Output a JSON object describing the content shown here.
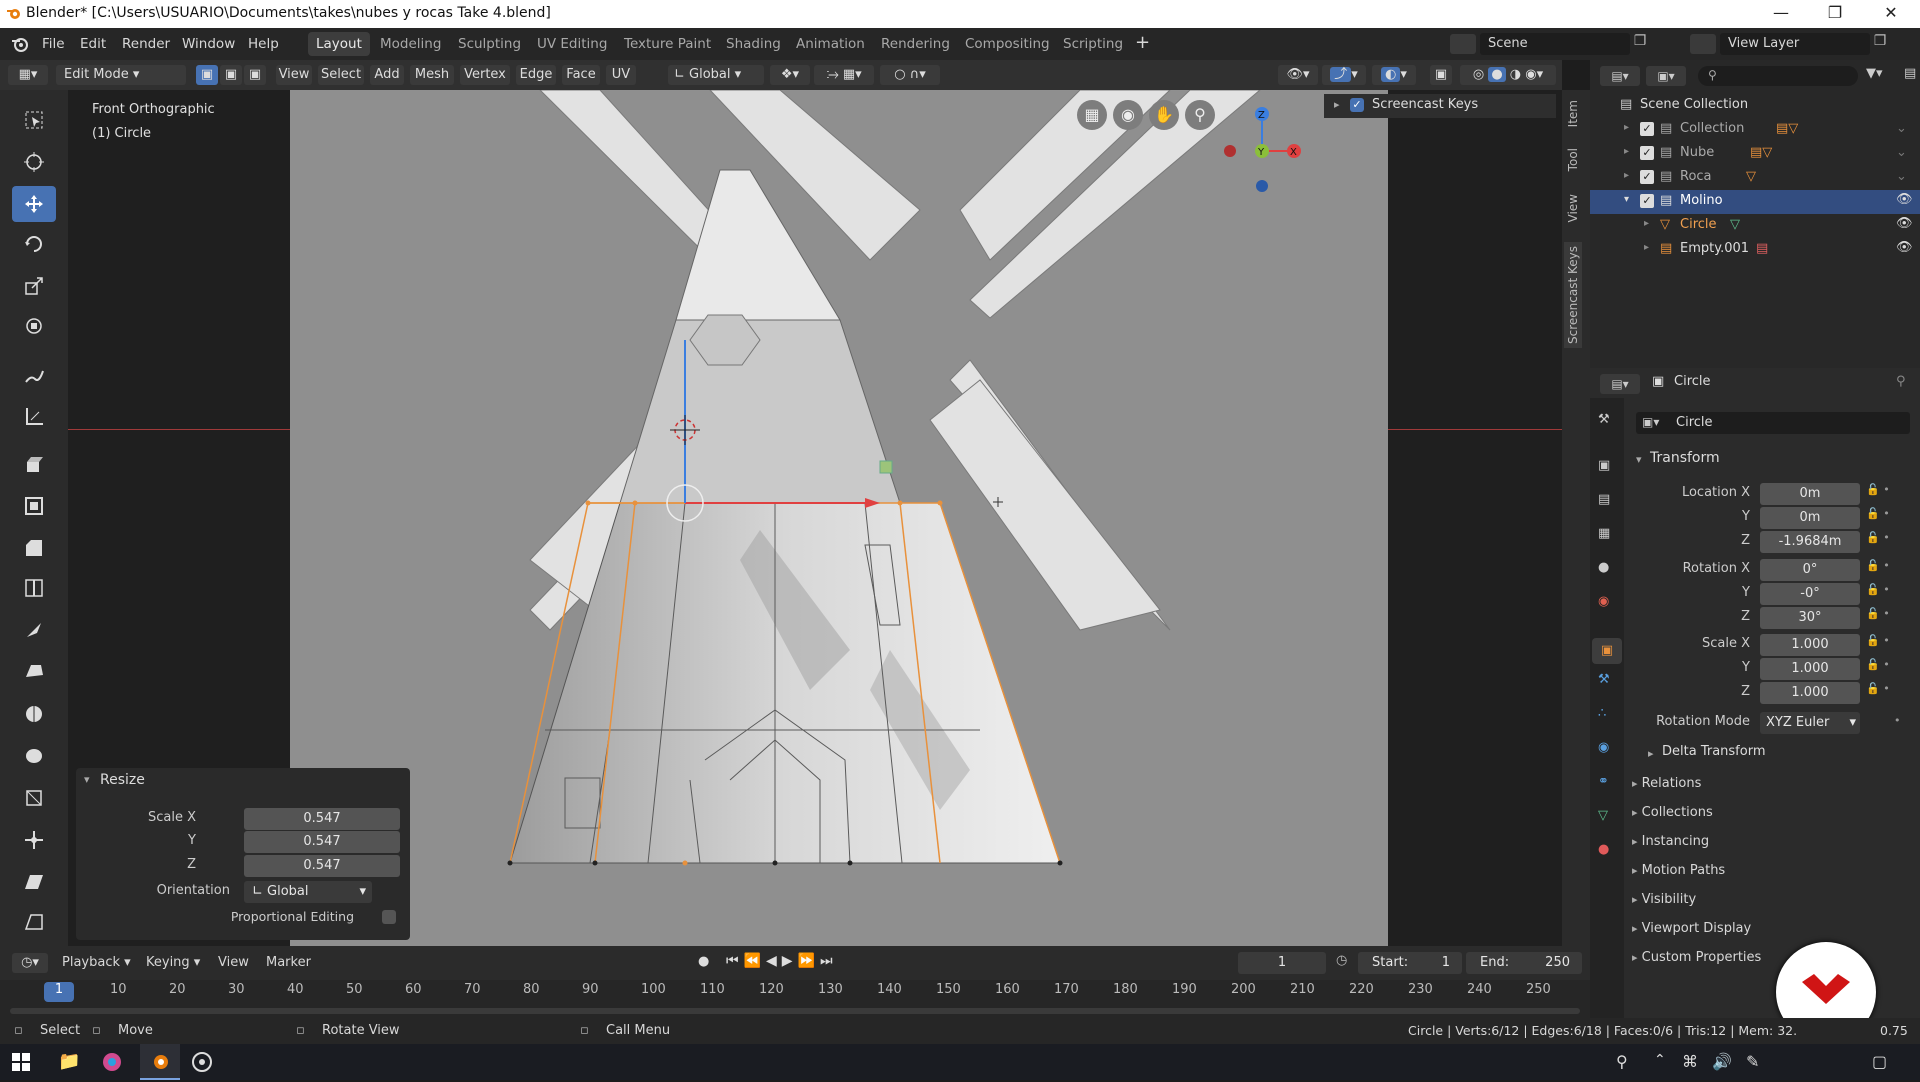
{
  "window": {
    "title": "Blender* [C:\\Users\\USUARIO\\Documents\\takes\\nubes y rocas Take 4.blend]"
  },
  "menu": [
    "File",
    "Edit",
    "Render",
    "Window",
    "Help"
  ],
  "workspaces": [
    "Layout",
    "Modeling",
    "Sculpting",
    "UV Editing",
    "Texture Paint",
    "Shading",
    "Animation",
    "Rendering",
    "Compositing",
    "Scripting"
  ],
  "active_workspace": "Layout",
  "scene": {
    "name": "Scene",
    "view_layer": "View Layer"
  },
  "viewport_header": {
    "mode": "Edit Mode",
    "menus": [
      "View",
      "Select",
      "Add",
      "Mesh",
      "Vertex",
      "Edge",
      "Face",
      "UV"
    ],
    "orientation": "Global"
  },
  "viewport": {
    "view_name": "Front Orthographic",
    "object_label": "(1) Circle",
    "gizmo": {
      "x": "X",
      "y": "Y",
      "z": "Z"
    }
  },
  "npanel_tabs": [
    "Item",
    "Tool",
    "View",
    "Screencast Keys"
  ],
  "screencast": {
    "label": "Screencast Keys"
  },
  "outliner": {
    "root": "Scene Collection",
    "items": [
      {
        "label": "Collection",
        "indent": 1
      },
      {
        "label": "Nube",
        "indent": 1
      },
      {
        "label": "Roca",
        "indent": 1
      },
      {
        "label": "Molino",
        "indent": 1,
        "selected": true
      },
      {
        "label": "Circle",
        "indent": 2
      },
      {
        "label": "Empty.001",
        "indent": 2
      }
    ]
  },
  "properties": {
    "object_name": "Circle",
    "datablock": "Circle",
    "transform_header": "Transform",
    "location": {
      "label_x": "Location X",
      "x": "0m",
      "y": "0m",
      "z": "-1.9684m"
    },
    "rotation": {
      "label_x": "Rotation X",
      "x": "0°",
      "y": "-0°",
      "z": "30°"
    },
    "scale": {
      "label_x": "Scale X",
      "x": "1.000",
      "y": "1.000",
      "z": "1.000"
    },
    "rotation_mode_label": "Rotation Mode",
    "rotation_mode": "XYZ Euler",
    "delta": "Delta Transform",
    "sections": [
      "Relations",
      "Collections",
      "Instancing",
      "Motion Paths",
      "Visibility",
      "Viewport Display",
      "Custom Properties"
    ]
  },
  "resize_panel": {
    "title": "Resize",
    "scale_x_label": "Scale X",
    "x": "0.547",
    "y": "0.547",
    "z": "0.547",
    "orientation_label": "Orientation",
    "orientation": "Global",
    "proportional": "Proportional Editing"
  },
  "timeline": {
    "menus": [
      "Playback",
      "Keying",
      "View",
      "Marker"
    ],
    "current_frame": "1",
    "start_label": "Start:",
    "start": "1",
    "end_label": "End:",
    "end": "250",
    "ruler": [
      "1",
      "10",
      "20",
      "30",
      "40",
      "50",
      "60",
      "70",
      "80",
      "90",
      "100",
      "110",
      "120",
      "130",
      "140",
      "150",
      "160",
      "170",
      "180",
      "190",
      "200",
      "210",
      "220",
      "230",
      "240",
      "250"
    ]
  },
  "status": {
    "select": "Select",
    "move": "Move",
    "rotate": "Rotate View",
    "call_menu": "Call Menu",
    "stats": "Circle | Verts:6/12 | Edges:6/18 | Faces:0/6 | Tris:12 | Mem: 32.",
    "version": "0.75"
  },
  "colors": {
    "accent": "#4772b3",
    "selected_row": "#334d80",
    "object_orange": "#e8913c"
  }
}
